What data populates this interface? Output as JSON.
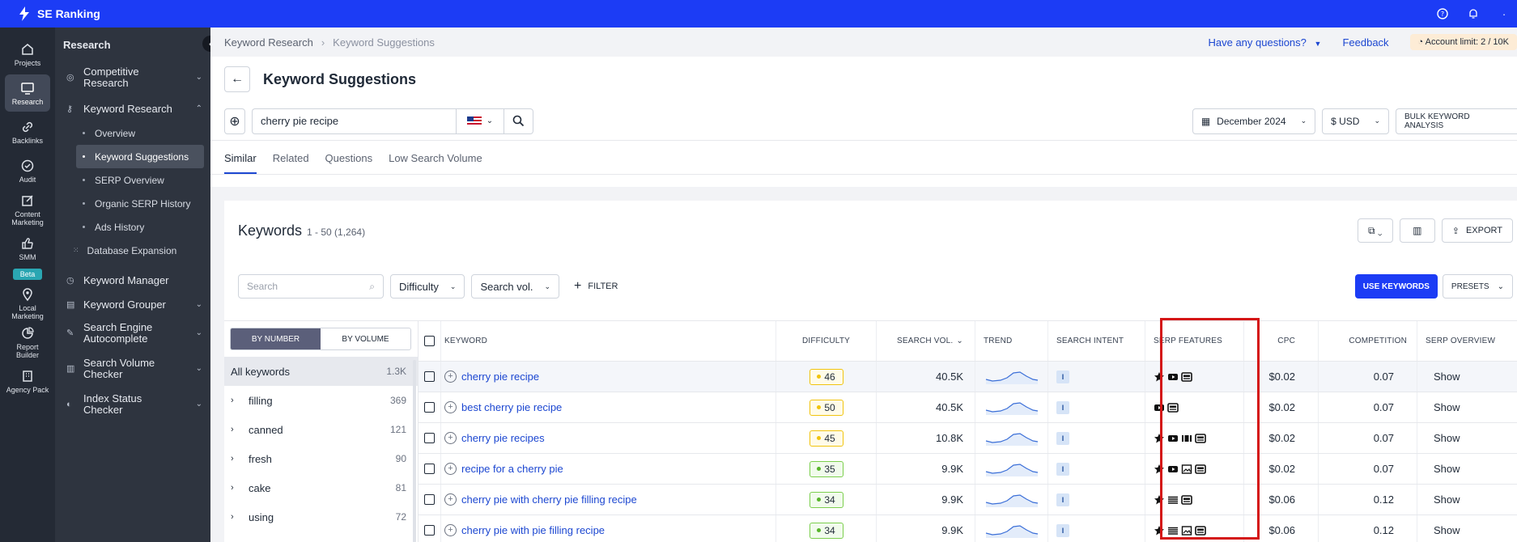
{
  "topbar": {
    "brand": "SE Ranking",
    "icons": [
      "help-icon",
      "bell-icon",
      "more-icon"
    ]
  },
  "rail": [
    {
      "label": "Projects",
      "icon": "home-icon"
    },
    {
      "label": "Research",
      "icon": "monitor-icon",
      "active": true
    },
    {
      "label": "Backlinks",
      "icon": "link-icon"
    },
    {
      "label": "Audit",
      "icon": "check-circle-icon"
    },
    {
      "label": "Content Marketing",
      "icon": "edit-icon"
    },
    {
      "label": "SMM",
      "icon": "thumb-icon",
      "badge": "Beta"
    },
    {
      "label": "Local Marketing",
      "icon": "pin-icon"
    },
    {
      "label": "Report Builder",
      "icon": "pie-icon"
    },
    {
      "label": "Agency Pack",
      "icon": "building-icon"
    }
  ],
  "sidebar": {
    "title": "Research",
    "items": [
      {
        "label": "Competitive Research",
        "chevron": "down"
      },
      {
        "label": "Keyword Research",
        "chevron": "up"
      },
      {
        "label": "Keyword Manager"
      },
      {
        "label": "Keyword Grouper",
        "chevron": "down"
      },
      {
        "label": "Search Engine Autocomplete",
        "chevron": "down"
      },
      {
        "label": "Search Volume Checker",
        "chevron": "down"
      },
      {
        "label": "Index Status Checker",
        "chevron": "down"
      }
    ],
    "subitems": [
      "Overview",
      "Keyword Suggestions",
      "SERP Overview",
      "Organic SERP History",
      "Ads History",
      "Database Expansion"
    ]
  },
  "breadcrumb": {
    "parent": "Keyword Research",
    "current": "Keyword Suggestions"
  },
  "header_right": {
    "questions": "Have any questions?",
    "feedback": "Feedback",
    "account_label": "Account limit:",
    "account_value": "2 / 10K"
  },
  "page": {
    "title": "Keyword Suggestions"
  },
  "search": {
    "value": "cherry pie recipe",
    "date": "December 2024",
    "currency": "$ USD",
    "bulk": "BULK KEYWORD ANALYSIS"
  },
  "tabs": [
    "Similar",
    "Related",
    "Questions",
    "Low Search Volume"
  ],
  "panel": {
    "title": "Keywords",
    "count": "1 - 50 (1,264)",
    "export": "EXPORT"
  },
  "filters": {
    "search_placeholder": "Search",
    "difficulty": "Difficulty",
    "volume": "Search vol.",
    "filter": "FILTER",
    "use_keywords": "USE KEYWORDS",
    "presets": "PRESETS"
  },
  "groups": {
    "seg": [
      "BY NUMBER",
      "BY VOLUME"
    ],
    "items": [
      {
        "label": "All keywords",
        "count": "1.3K"
      },
      {
        "label": "filling",
        "count": "369"
      },
      {
        "label": "canned",
        "count": "121"
      },
      {
        "label": "fresh",
        "count": "90"
      },
      {
        "label": "cake",
        "count": "81"
      },
      {
        "label": "using",
        "count": "72"
      }
    ]
  },
  "table": {
    "headers": {
      "keyword": "KEYWORD",
      "difficulty": "DIFFICULTY",
      "volume": "SEARCH VOL.",
      "trend": "TREND",
      "intent": "SEARCH INTENT",
      "serp": "SERP FEATURES",
      "cpc": "CPC",
      "competition": "COMPETITION",
      "overview": "SERP OVERVIEW"
    },
    "rows": [
      {
        "keyword": "cherry pie recipe",
        "difficulty": "46",
        "diff_color": "yellow",
        "volume": "40.5K",
        "intent": "I",
        "serp": [
          "star",
          "video",
          "image"
        ],
        "cpc": "$0.02",
        "competition": "0.07",
        "overview": "Show"
      },
      {
        "keyword": "best cherry pie recipe",
        "difficulty": "50",
        "diff_color": "yellow",
        "volume": "40.5K",
        "intent": "I",
        "serp": [
          "video",
          "image"
        ],
        "cpc": "$0.02",
        "competition": "0.07",
        "overview": "Show"
      },
      {
        "keyword": "cherry pie recipes",
        "difficulty": "45",
        "diff_color": "yellow",
        "volume": "10.8K",
        "intent": "I",
        "serp": [
          "star",
          "video",
          "carousel",
          "image"
        ],
        "cpc": "$0.02",
        "competition": "0.07",
        "overview": "Show"
      },
      {
        "keyword": "recipe for a cherry pie",
        "difficulty": "35",
        "diff_color": "green",
        "volume": "9.9K",
        "intent": "I",
        "serp": [
          "star",
          "video",
          "photo",
          "image"
        ],
        "cpc": "$0.02",
        "competition": "0.07",
        "overview": "Show"
      },
      {
        "keyword": "cherry pie with cherry pie filling recipe",
        "difficulty": "34",
        "diff_color": "green",
        "volume": "9.9K",
        "intent": "I",
        "serp": [
          "star",
          "list",
          "image"
        ],
        "cpc": "$0.06",
        "competition": "0.12",
        "overview": "Show"
      },
      {
        "keyword": "cherry pie with pie filling recipe",
        "difficulty": "34",
        "diff_color": "green",
        "volume": "9.9K",
        "intent": "I",
        "serp": [
          "star",
          "list",
          "photo",
          "image"
        ],
        "cpc": "$0.06",
        "competition": "0.12",
        "overview": "Show"
      }
    ]
  }
}
